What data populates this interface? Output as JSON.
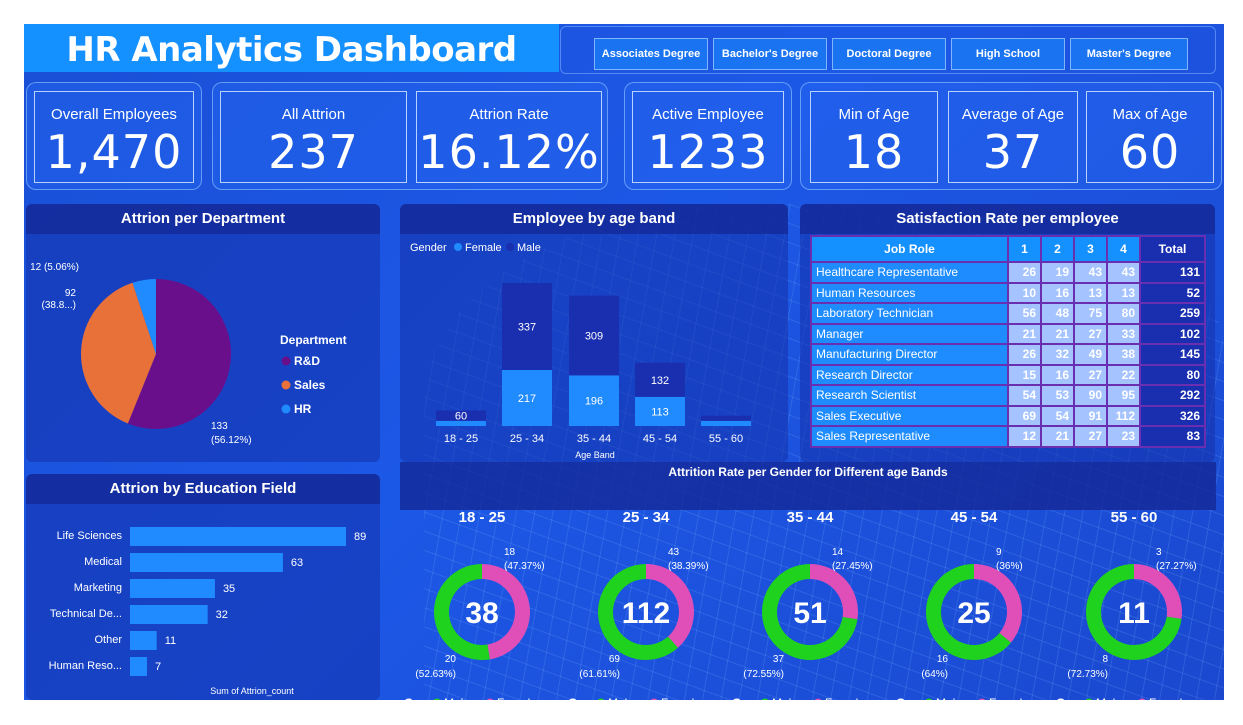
{
  "title": "HR Analytics Dashboard",
  "slicers": [
    "Associates Degree",
    "Bachelor's Degree",
    "Doctoral Degree",
    "High School",
    "Master's Degree"
  ],
  "kpis": {
    "overall": {
      "label": "Overall Employees",
      "value": "1,470"
    },
    "attrition": {
      "label": "All Attrion",
      "value": "237"
    },
    "rate": {
      "label": "Attrion Rate",
      "value": "16.12%"
    },
    "active": {
      "label": "Active Employee",
      "value": "1233"
    },
    "min_age": {
      "label": "Min of Age",
      "value": "18"
    },
    "avg_age": {
      "label": "Average of Age",
      "value": "37"
    },
    "max_age": {
      "label": "Max of Age",
      "value": "60"
    }
  },
  "colors": {
    "rd": "#6a0f8c",
    "sales": "#e8713a",
    "hr": "#1f8bff",
    "female": "#1f8bff",
    "male": "#1a2fb0",
    "donut_male": "#1ed21e",
    "donut_female": "#e04fb8"
  },
  "chart_data": [
    {
      "type": "pie",
      "title": "Attrion per Department",
      "legend_title": "Department",
      "legend_position": "right",
      "slices": [
        {
          "name": "R&D",
          "value": 133,
          "label": "133",
          "pct_label": "(56.12%)"
        },
        {
          "name": "Sales",
          "value": 92,
          "label": "92",
          "pct_label": "(38.8...)"
        },
        {
          "name": "HR",
          "value": 12,
          "label": "12 (5.06%)",
          "pct_label": ""
        }
      ]
    },
    {
      "type": "bar",
      "stacked": true,
      "title": "Employee by age band",
      "legend_title": "Gender",
      "xlabel": "Age Band",
      "categories": [
        "18 - 25",
        "25 - 34",
        "35 - 44",
        "45 - 54",
        "55 - 60"
      ],
      "series": [
        {
          "name": "Female",
          "values": [
            20,
            217,
            196,
            113,
            20
          ],
          "labels": [
            "",
            "217",
            "196",
            "113",
            ""
          ]
        },
        {
          "name": "Male",
          "values": [
            40,
            337,
            309,
            132,
            20
          ],
          "labels": [
            "60",
            "337",
            "309",
            "132",
            ""
          ]
        }
      ]
    },
    {
      "type": "table",
      "title": "Satisfaction Rate per employee",
      "columns": [
        "Job Role",
        "1",
        "2",
        "3",
        "4",
        "Total"
      ],
      "rows": [
        [
          "Healthcare Representative",
          "26",
          "19",
          "43",
          "43",
          "131"
        ],
        [
          "Human Resources",
          "10",
          "16",
          "13",
          "13",
          "52"
        ],
        [
          "Laboratory Technician",
          "56",
          "48",
          "75",
          "80",
          "259"
        ],
        [
          "Manager",
          "21",
          "21",
          "27",
          "33",
          "102"
        ],
        [
          "Manufacturing Director",
          "26",
          "32",
          "49",
          "38",
          "145"
        ],
        [
          "Research Director",
          "15",
          "16",
          "27",
          "22",
          "80"
        ],
        [
          "Research Scientist",
          "54",
          "53",
          "90",
          "95",
          "292"
        ],
        [
          "Sales Executive",
          "69",
          "54",
          "91",
          "112",
          "326"
        ],
        [
          "Sales Representative",
          "12",
          "21",
          "27",
          "23",
          "83"
        ]
      ]
    },
    {
      "type": "bar",
      "orientation": "horizontal",
      "title": "Attrion by Education Field",
      "xlabel": "Sum of Attrion_count",
      "categories": [
        "Life Sciences",
        "Medical",
        "Marketing",
        "Technical De...",
        "Other",
        "Human Reso..."
      ],
      "values": [
        89,
        63,
        35,
        32,
        11,
        7
      ]
    },
    {
      "type": "pie",
      "donut": true,
      "title": "Attrition Rate per Gender for Different age Bands",
      "legend_title": "G...",
      "legend": [
        "Male",
        "Female"
      ],
      "bands": [
        {
          "band": "18 - 25",
          "total": "38",
          "female": 18,
          "female_label": "18",
          "female_pct": "(47.37%)",
          "male": 20,
          "male_label": "20",
          "male_pct": "(52.63%)"
        },
        {
          "band": "25 - 34",
          "total": "112",
          "female": 43,
          "female_label": "43",
          "female_pct": "(38.39%)",
          "male": 69,
          "male_label": "69",
          "male_pct": "(61.61%)"
        },
        {
          "band": "35 - 44",
          "total": "51",
          "female": 14,
          "female_label": "14",
          "female_pct": "(27.45%)",
          "male": 37,
          "male_label": "37",
          "male_pct": "(72.55%)"
        },
        {
          "band": "45 - 54",
          "total": "25",
          "female": 9,
          "female_label": "9",
          "female_pct": "(36%)",
          "male": 16,
          "male_label": "16",
          "male_pct": "(64%)"
        },
        {
          "band": "55 - 60",
          "total": "11",
          "female": 3,
          "female_label": "3",
          "female_pct": "(27.27%)",
          "male": 8,
          "male_label": "8",
          "male_pct": "(72.73%)"
        }
      ]
    }
  ]
}
